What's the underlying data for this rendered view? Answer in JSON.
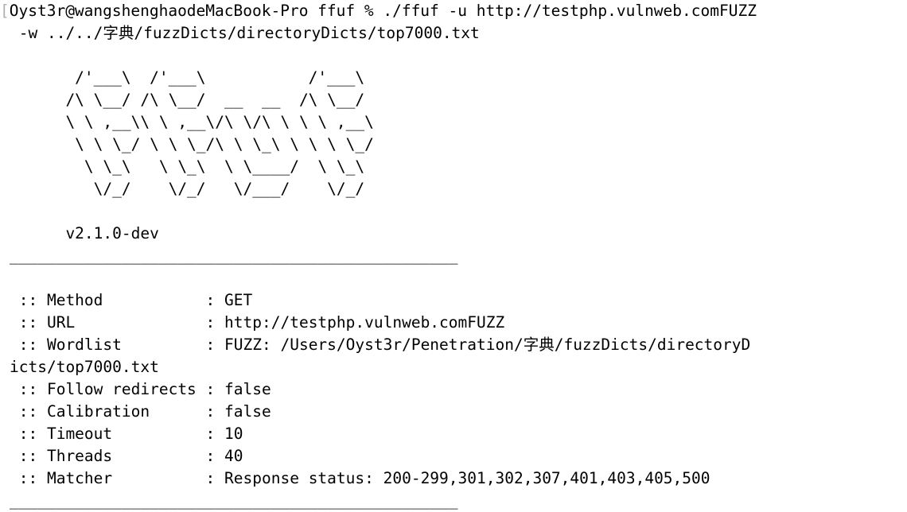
{
  "terminal": {
    "prompt_bracket": "[",
    "command_line_1": "Oyst3r@wangshenghaodeMacBook-Pro ffuf % ./ffuf -u http://testphp.vulnweb.comFUZZ",
    "command_line_2": " -w ../../字典/fuzzDicts/directoryDicts/top7000.txt",
    "banner": [
      "       /'___\\  /'___\\           /'___\\",
      "      /\\ \\__/ /\\ \\__/  __  __  /\\ \\__/",
      "      \\ \\ ,__\\\\ \\ ,__\\/\\ \\/\\ \\ \\ \\ ,__\\",
      "       \\ \\ \\_/ \\ \\ \\_/\\ \\ \\_\\ \\ \\ \\ \\_/",
      "        \\ \\_\\   \\ \\_\\  \\ \\____/  \\ \\_\\",
      "         \\/_/    \\/_/   \\/___/    \\/_/"
    ],
    "version": "      v2.1.0-dev",
    "separator": "________________________________________________",
    "config": [
      {
        "label": " :: Method           : ",
        "value": "GET"
      },
      {
        "label": " :: URL              : ",
        "value": "http://testphp.vulnweb.comFUZZ"
      },
      {
        "label": " :: Wordlist         : ",
        "value": "FUZZ: /Users/Oyst3r/Penetration/字典/fuzzDicts/directoryD"
      },
      {
        "label": "",
        "value": "icts/top7000.txt"
      },
      {
        "label": " :: Follow redirects : ",
        "value": "false"
      },
      {
        "label": " :: Calibration      : ",
        "value": "false"
      },
      {
        "label": " :: Timeout          : ",
        "value": "10"
      },
      {
        "label": " :: Threads          : ",
        "value": "40"
      },
      {
        "label": " :: Matcher          : ",
        "value": "Response status: 200-299,301,302,307,401,403,405,500"
      }
    ],
    "separator_bottom": "________________________________________________"
  }
}
